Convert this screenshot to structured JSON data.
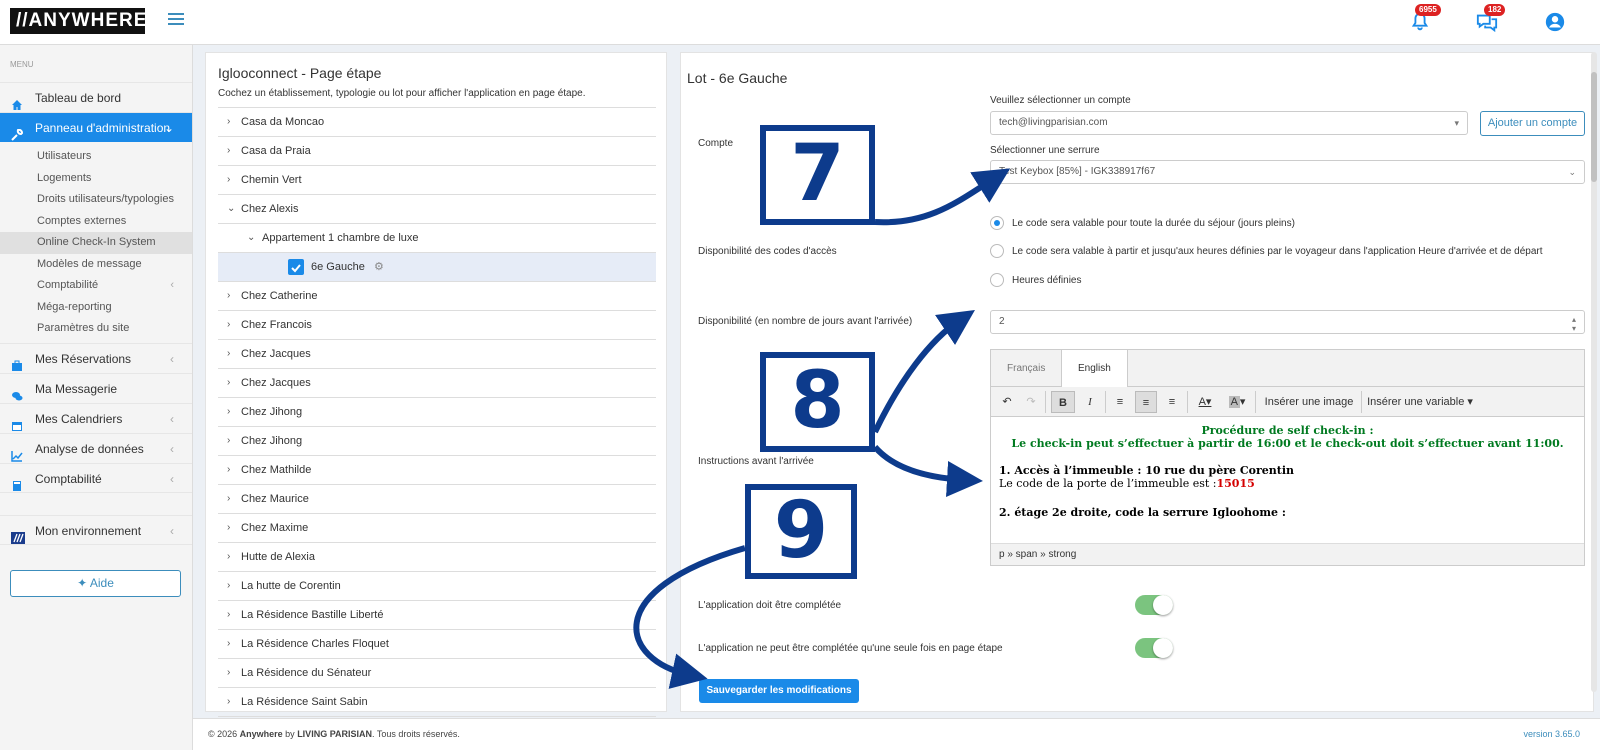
{
  "header": {
    "logo": "//ANYWHERE",
    "notifications_badge": "6955",
    "messages_badge": "182"
  },
  "sidebar": {
    "menu_header": "MENU",
    "items": [
      {
        "label": "Tableau de bord",
        "icon": "home-icon"
      },
      {
        "label": "Panneau d'administration",
        "icon": "wrench-icon"
      }
    ],
    "sub_items": [
      "Utilisateurs",
      "Logements",
      "Droits utilisateurs/typologies",
      "Comptes externes",
      "Online Check-In System",
      "Modèles de message",
      "Comptabilité",
      "Méga-reporting",
      "Paramètres du site"
    ],
    "items_after": [
      {
        "label": "Mes Réservations",
        "icon": "briefcase-icon"
      },
      {
        "label": "Ma Messagerie",
        "icon": "chat-icon"
      },
      {
        "label": "Mes Calendriers",
        "icon": "calendar-icon"
      },
      {
        "label": "Analyse de données",
        "icon": "chart-icon"
      },
      {
        "label": "Comptabilité",
        "icon": "calculator-icon"
      }
    ],
    "env": "Mon environnement",
    "aide": "Aide"
  },
  "left_panel": {
    "title": "Iglooconnect - Page étape",
    "subtitle": "Cochez un établissement, typologie ou lot pour afficher l'application en page étape.",
    "tree": [
      "Casa da Moncao",
      "Casa da Praia",
      "Chemin Vert",
      "Chez Alexis",
      "Appartement 1 chambre de luxe",
      "6e Gauche",
      "Chez Catherine",
      "Chez Francois",
      "Chez Jacques",
      "Chez Jacques",
      "Chez Jihong",
      "Chez Jihong",
      "Chez Mathilde",
      "Chez Maurice",
      "Chez Maxime",
      "Hutte de Alexia",
      "La hutte de Corentin",
      "La Résidence Bastille Liberté",
      "La Résidence Charles Floquet",
      "La Résidence du Sénateur",
      "La Résidence Saint Sabin"
    ]
  },
  "right_panel": {
    "title": "Lot - 6e Gauche",
    "compte_label": "Compte",
    "select_account_label": "Veuillez sélectionner un compte",
    "account_value": "tech@livingparisian.com",
    "add_account_button": "Ajouter un compte",
    "select_lock_label": "Sélectionner une serrure",
    "lock_value": "Test Keybox [85%] - IGK338917f67",
    "availability_label": "Disponibilité des codes d'accès",
    "radio_options": [
      "Le code sera valable pour toute la durée du séjour (jours pleins)",
      "Le code sera valable à partir et jusqu'aux heures définies par le voyageur dans l'application Heure d'arrivée et de départ",
      "Heures définies"
    ],
    "days_label": "Disponibilité (en nombre de jours avant l'arrivée)",
    "days_value": "2",
    "instructions_label": "Instructions avant l'arrivée",
    "editor": {
      "tabs": [
        "Français",
        "English"
      ],
      "insert_image": "Insérer une image",
      "insert_variable": "Insérer une variable",
      "line1": "Procédure de self check-in :",
      "line2": "Le check-in peut s’effectuer à partir de 16:00 et le check-out doit s’effectuer avant 11:00.",
      "step1_title": "1. Accès à l’immeuble : 10 rue du père Corentin",
      "step1_text": "Le code de la porte de l’immeuble est :",
      "step1_code": "15015",
      "step2_title": "2. étage 2e droite, code la serrure Igloohome :",
      "status_path": "p » span » strong"
    },
    "toggle1_label": "L'application doit être complétée",
    "toggle2_label": "L'application ne peut être complétée qu'une seule fois en page étape",
    "save_button": "Sauvegarder les modifications"
  },
  "footer": {
    "copyright_prefix": "© 2026 ",
    "brand": "Anywhere",
    "by": " by ",
    "company": "LIVING PARISIAN",
    "suffix": ". Tous droits réservés.",
    "version": "version 3.65.0"
  },
  "annotations": [
    "7",
    "8",
    "9"
  ],
  "colors": {
    "accent": "#1a8ae8",
    "annotation": "#0d3b8c",
    "toggle_on": "#7bc47f"
  }
}
